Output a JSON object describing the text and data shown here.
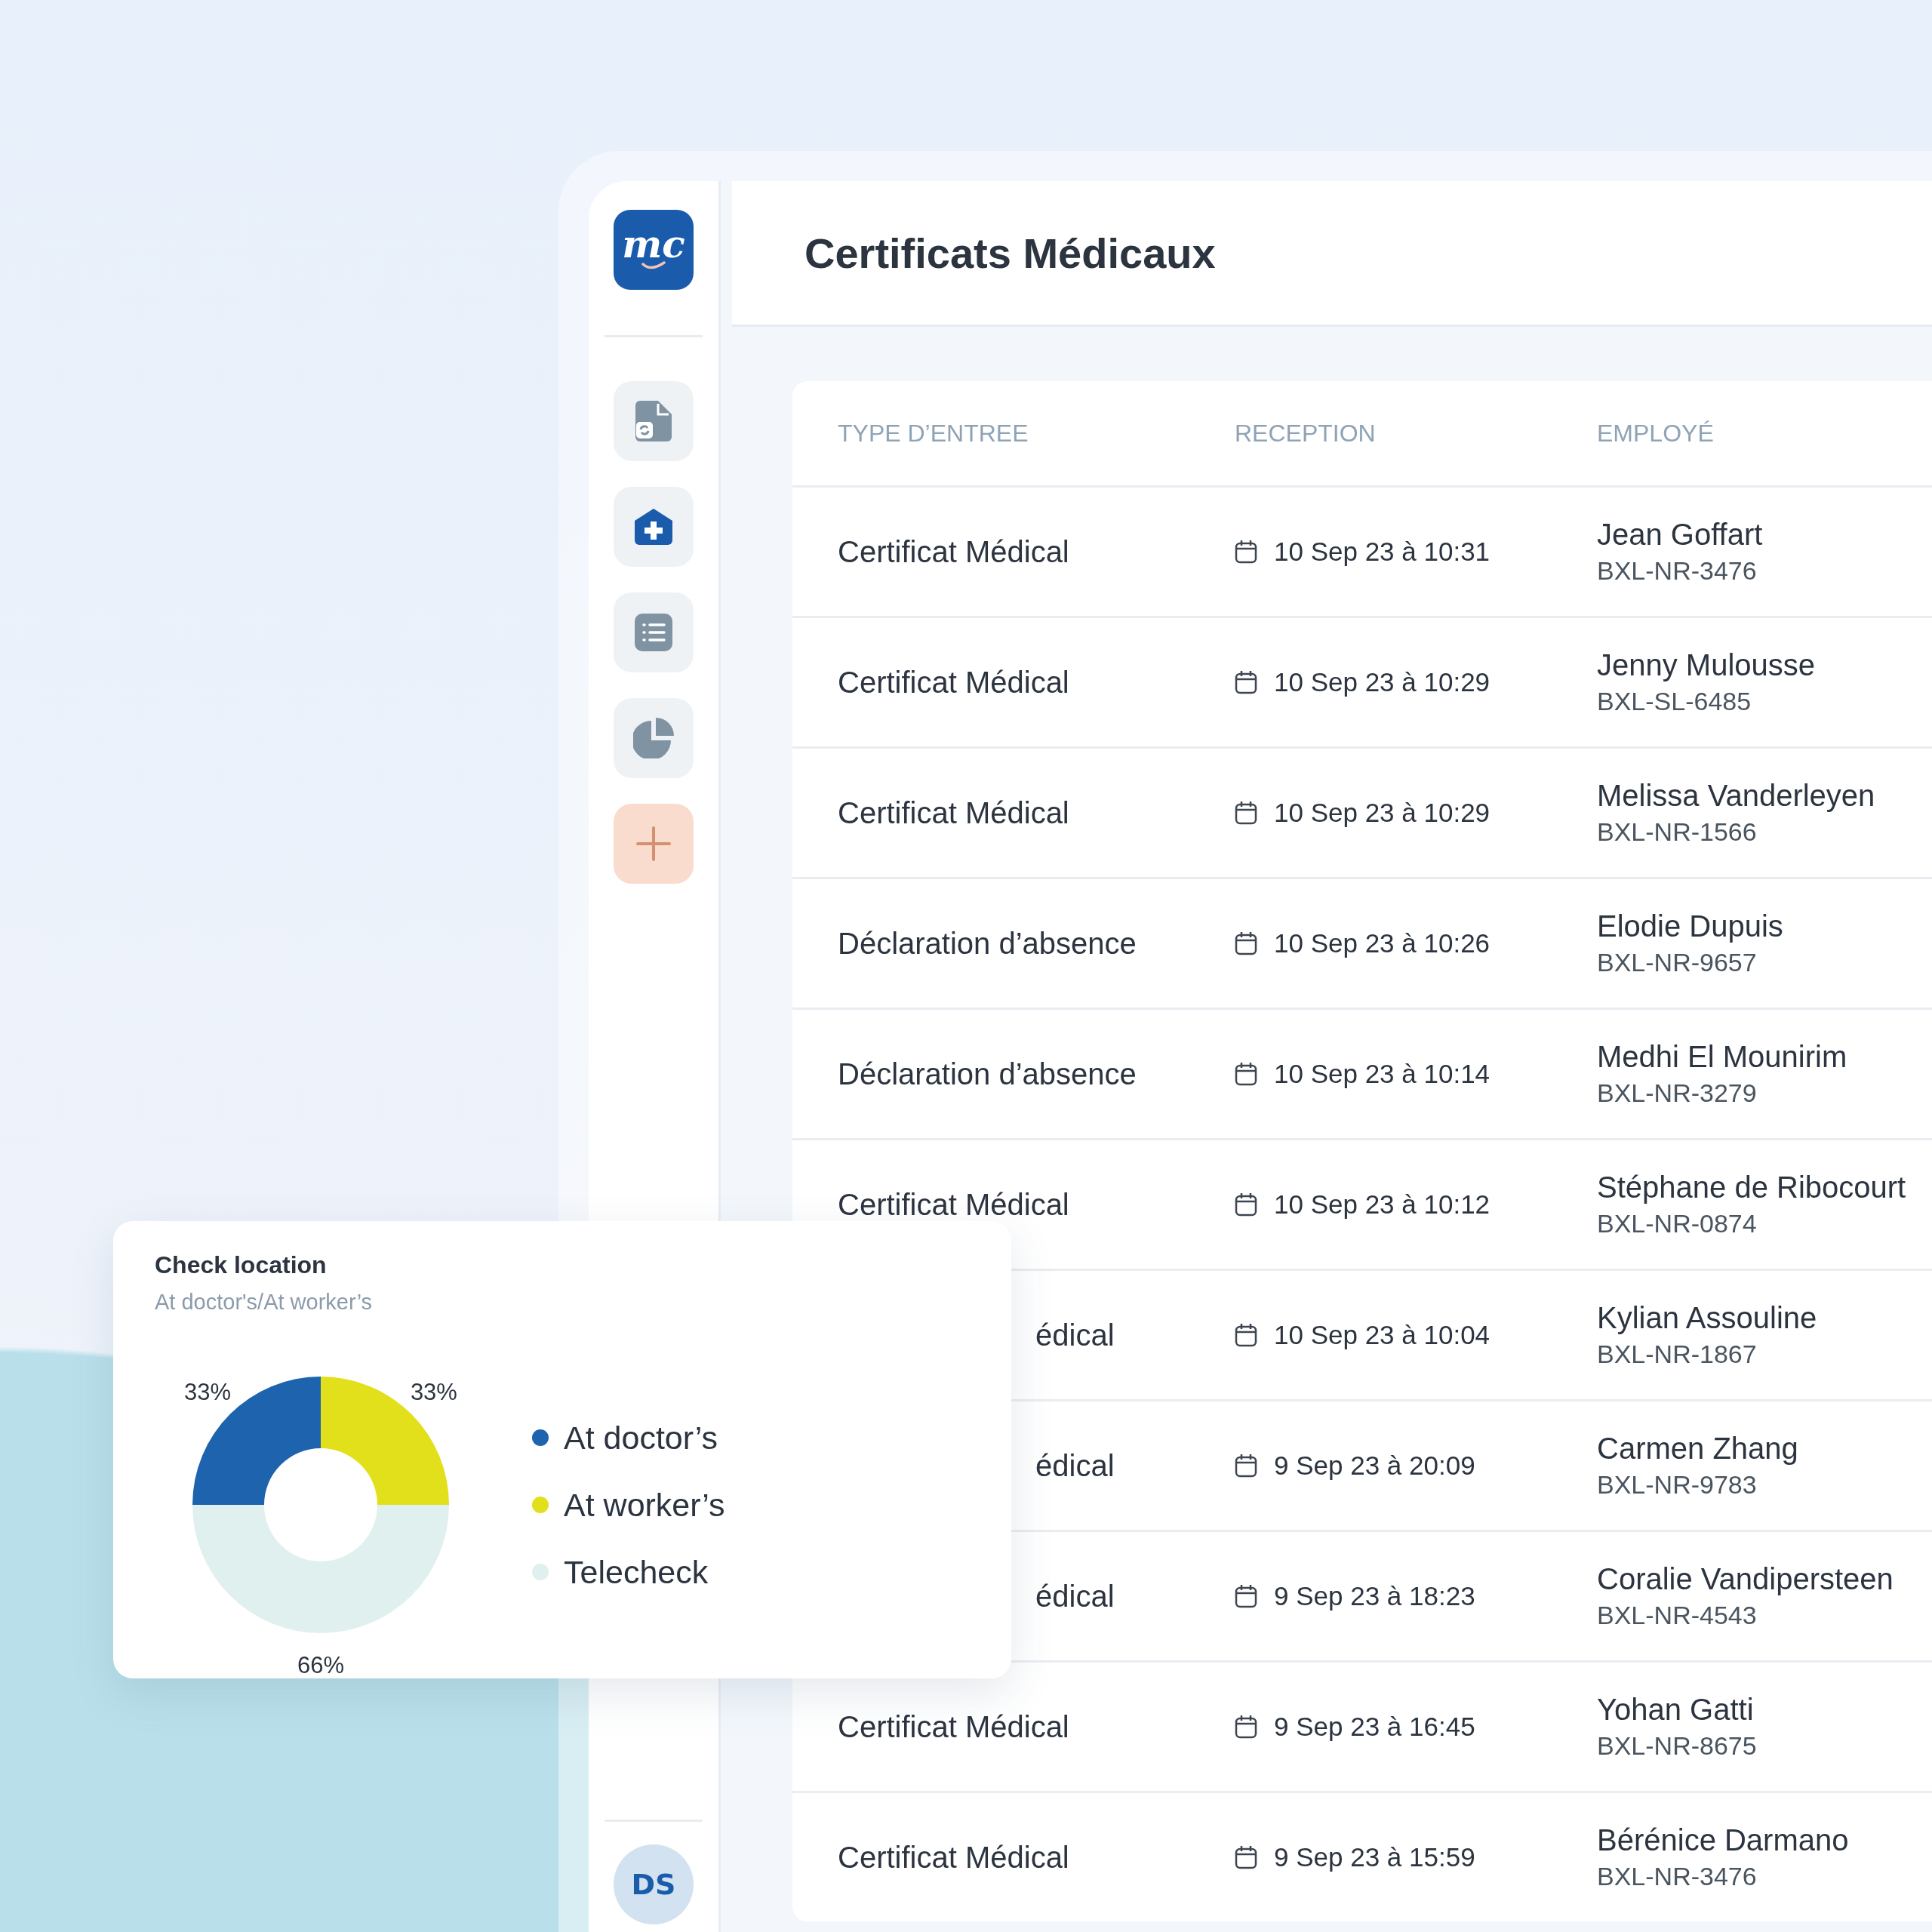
{
  "sidebar": {
    "logo": "mc",
    "items": [
      {
        "kind": "document",
        "selected": false
      },
      {
        "kind": "medical",
        "selected": true
      },
      {
        "kind": "list",
        "selected": false
      },
      {
        "kind": "chart",
        "selected": false
      },
      {
        "kind": "add",
        "selected": false
      }
    ],
    "avatar": "DS"
  },
  "header": {
    "title": "Certificats Médicaux"
  },
  "table": {
    "columns": [
      "TYPE D’ENTREE",
      "RECEPTION",
      "EMPLOYÉ"
    ],
    "rows": [
      {
        "type": "Certificat Médical",
        "reception": "10 Sep 23 à 10:31",
        "employee": "Jean Goffart",
        "id": "BXL-NR-3476"
      },
      {
        "type": "Certificat Médical",
        "reception": "10 Sep 23 à 10:29",
        "employee": "Jenny Mulousse",
        "id": "BXL-SL-6485"
      },
      {
        "type": "Certificat Médical",
        "reception": "10 Sep 23 à 10:29",
        "employee": "Melissa Vanderleyen",
        "id": "BXL-NR-1566"
      },
      {
        "type": "Déclaration d’absence",
        "reception": "10 Sep 23 à 10:26",
        "employee": "Elodie Dupuis",
        "id": "BXL-NR-9657"
      },
      {
        "type": "Déclaration d’absence",
        "reception": "10 Sep 23 à 10:14",
        "employee": "Medhi El Mounirim",
        "id": "BXL-NR-3279"
      },
      {
        "type": "Certificat Médical",
        "reception": "10 Sep 23 à 10:12",
        "employee": "Stéphane de Ribocourt",
        "id": "BXL-NR-0874"
      },
      {
        "type": "édical",
        "partly_hidden": true,
        "reception": "10 Sep 23 à 10:04",
        "employee": "Kylian Assouline",
        "id": "BXL-NR-1867"
      },
      {
        "type": "édical",
        "partly_hidden": true,
        "reception": "9 Sep 23 à 20:09",
        "employee": "Carmen Zhang",
        "id": "BXL-NR-9783"
      },
      {
        "type": "édical",
        "partly_hidden": true,
        "reception": "9 Sep 23 à 18:23",
        "employee": "Coralie Vandipersteen",
        "id": "BXL-NR-4543"
      },
      {
        "type": "Certificat Médical",
        "reception": "9 Sep 23 à 16:45",
        "employee": "Yohan Gatti",
        "id": "BXL-NR-8675"
      },
      {
        "type": "Certificat Médical",
        "reception": "9 Sep 23 à 15:59",
        "employee": "Bérénice Darmano",
        "id": "BXL-NR-3476"
      }
    ]
  },
  "chart_card": {
    "title": "Check location",
    "subtitle": "At doctor's/At worker’s",
    "chart_data": {
      "type": "donut",
      "categories": [
        "At doctor’s",
        "At worker’s",
        "Telecheck"
      ],
      "values": [
        33,
        33,
        66
      ],
      "colors": [
        "#1d63ae",
        "#e2e01a",
        "#dff0ee"
      ],
      "data_labels": true,
      "value_labels": [
        "33%",
        "33%",
        "66%"
      ]
    }
  }
}
